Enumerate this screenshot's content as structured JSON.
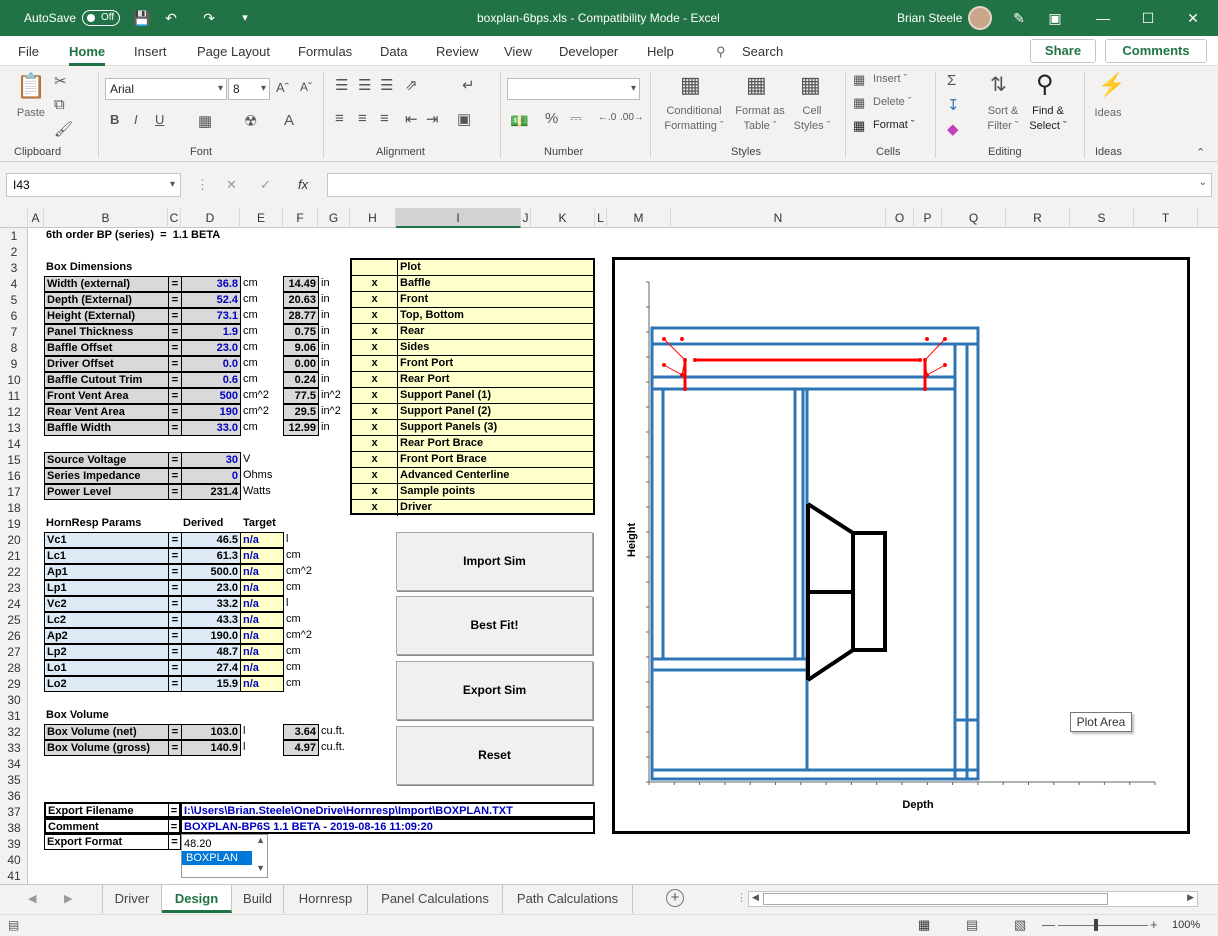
{
  "titlebar": {
    "autosave": "AutoSave",
    "toggle": "Off",
    "filename": "boxplan-6bps.xls",
    "mode": "Compatibility Mode",
    "app": "Excel",
    "user": "Brian Steele"
  },
  "menu": {
    "items": [
      "File",
      "Home",
      "Insert",
      "Page Layout",
      "Formulas",
      "Data",
      "Review",
      "View",
      "Developer",
      "Help"
    ],
    "search": "Search",
    "share": "Share",
    "comments": "Comments"
  },
  "ribbon": {
    "clipboard": {
      "label": "Clipboard",
      "paste": "Paste"
    },
    "font": {
      "label": "Font",
      "name": "Arial",
      "size": "8",
      "bold": "B",
      "italic": "I",
      "underline": "U"
    },
    "alignment": {
      "label": "Alignment"
    },
    "number": {
      "label": "Number",
      "format": ""
    },
    "styles": {
      "label": "Styles",
      "cond1": "Conditional",
      "cond2": "Formatting",
      "fmt1": "Format as",
      "fmt2": "Table",
      "cell1": "Cell",
      "cell2": "Styles"
    },
    "cells": {
      "label": "Cells",
      "insert": "Insert",
      "delete": "Delete",
      "format": "Format"
    },
    "editing": {
      "label": "Editing",
      "sort1": "Sort &",
      "sort2": "Filter",
      "find1": "Find &",
      "find2": "Select"
    },
    "ideas": {
      "label": "Ideas",
      "btn": "Ideas"
    }
  },
  "formula": {
    "namebox": "I43",
    "fx": "fx",
    "value": ""
  },
  "columns": [
    "A",
    "B",
    "C",
    "D",
    "E",
    "F",
    "G",
    "H",
    "I",
    "J",
    "K",
    "L",
    "M",
    "N",
    "O",
    "P",
    "Q",
    "R",
    "S",
    "T"
  ],
  "rows": [
    "1",
    "2",
    "3",
    "4",
    "5",
    "6",
    "7",
    "8",
    "9",
    "10",
    "11",
    "12",
    "13",
    "14",
    "15",
    "16",
    "17",
    "18",
    "19",
    "20",
    "21",
    "22",
    "23",
    "24",
    "25",
    "26",
    "27",
    "28",
    "29",
    "30",
    "31",
    "32",
    "33",
    "34",
    "35",
    "36",
    "37",
    "38",
    "39",
    "40",
    "41"
  ],
  "sheet": {
    "title": "6th order BP (series)",
    "title_eq": "=",
    "version": "1.1 BETA",
    "box_dims_header": "Box Dimensions",
    "dims": [
      {
        "label": "Width (external)",
        "value": "36.8",
        "unit": "cm",
        "imp": "14.49",
        "iunit": "in"
      },
      {
        "label": "Depth (External)",
        "value": "52.4",
        "unit": "cm",
        "imp": "20.63",
        "iunit": "in"
      },
      {
        "label": "Height (External)",
        "value": "73.1",
        "unit": "cm",
        "imp": "28.77",
        "iunit": "in"
      },
      {
        "label": "Panel Thickness",
        "value": "1.9",
        "unit": "cm",
        "imp": "0.75",
        "iunit": "in"
      },
      {
        "label": "Baffle Offset",
        "value": "23.0",
        "unit": "cm",
        "imp": "9.06",
        "iunit": "in"
      },
      {
        "label": "Driver Offset",
        "value": "0.0",
        "unit": "cm",
        "imp": "0.00",
        "iunit": "in"
      },
      {
        "label": "Baffle Cutout Trim",
        "value": "0.6",
        "unit": "cm",
        "imp": "0.24",
        "iunit": "in"
      },
      {
        "label": "Front Vent Area",
        "value": "500",
        "unit": "cm^2",
        "imp": "77.5",
        "iunit": "in^2"
      },
      {
        "label": "Rear Vent Area",
        "value": "190",
        "unit": "cm^2",
        "imp": "29.5",
        "iunit": "in^2"
      },
      {
        "label": "Baffle Width",
        "value": "33.0",
        "unit": "cm",
        "imp": "12.99",
        "iunit": "in"
      }
    ],
    "elec": [
      {
        "label": "Source Voltage",
        "value": "30",
        "unit": "V"
      },
      {
        "label": "Series Impedance",
        "value": "0",
        "unit": "Ohms"
      },
      {
        "label": "Power Level",
        "value": "231.4",
        "unit": "Watts"
      }
    ],
    "hornresp_header": "HornResp Params",
    "derived_header": "Derived",
    "target_header": "Target",
    "params": [
      {
        "label": "Vc1",
        "value": "46.5",
        "target": "n/a",
        "unit": "l"
      },
      {
        "label": "Lc1",
        "value": "61.3",
        "target": "n/a",
        "unit": "cm"
      },
      {
        "label": "Ap1",
        "value": "500.0",
        "target": "n/a",
        "unit": "cm^2"
      },
      {
        "label": "Lp1",
        "value": "23.0",
        "target": "n/a",
        "unit": "cm"
      },
      {
        "label": "Vc2",
        "value": "33.2",
        "target": "n/a",
        "unit": "l"
      },
      {
        "label": "Lc2",
        "value": "43.3",
        "target": "n/a",
        "unit": "cm"
      },
      {
        "label": "Ap2",
        "value": "190.0",
        "target": "n/a",
        "unit": "cm^2"
      },
      {
        "label": "Lp2",
        "value": "48.7",
        "target": "n/a",
        "unit": "cm"
      },
      {
        "label": "Lo1",
        "value": "27.4",
        "target": "n/a",
        "unit": "cm"
      },
      {
        "label": "Lo2",
        "value": "15.9",
        "target": "n/a",
        "unit": "cm"
      }
    ],
    "volume_header": "Box Volume",
    "volumes": [
      {
        "label": "Box Volume (net)",
        "value": "103.0",
        "unit": "l",
        "imp": "3.64",
        "iunit": "cu.ft."
      },
      {
        "label": "Box Volume (gross)",
        "value": "140.9",
        "unit": "l",
        "imp": "4.97",
        "iunit": "cu.ft."
      }
    ],
    "eq": "=",
    "plot_header": "Plot",
    "plot_items": [
      {
        "mark": "x",
        "name": "Baffle"
      },
      {
        "mark": "x",
        "name": "Front"
      },
      {
        "mark": "x",
        "name": "Top, Bottom"
      },
      {
        "mark": "x",
        "name": "Rear"
      },
      {
        "mark": "x",
        "name": "Sides"
      },
      {
        "mark": "x",
        "name": "Front Port"
      },
      {
        "mark": "x",
        "name": "Rear Port"
      },
      {
        "mark": "x",
        "name": "Support Panel (1)"
      },
      {
        "mark": "x",
        "name": "Support Panel (2)"
      },
      {
        "mark": "x",
        "name": "Support Panels (3)"
      },
      {
        "mark": "x",
        "name": "Rear Port Brace"
      },
      {
        "mark": "x",
        "name": "Front Port Brace"
      },
      {
        "mark": "x",
        "name": "Advanced Centerline"
      },
      {
        "mark": "x",
        "name": "Sample points"
      },
      {
        "mark": "x",
        "name": "Driver"
      }
    ],
    "buttons": [
      "Import Sim",
      "Best Fit!",
      "Export Sim",
      "Reset"
    ],
    "export": {
      "filename_label": "Export Filename",
      "filename": "I:\\Users\\Brian.Steele\\OneDrive\\Hornresp\\Import\\BOXPLAN.TXT",
      "comment_label": "Comment",
      "comment": "BOXPLAN-BP6S 1.1 BETA - 2019-08-16 11:09:20",
      "format_label": "Export Format",
      "format_options": [
        "48.20",
        "BOXPLAN"
      ]
    }
  },
  "chart": {
    "xlabel": "Depth",
    "ylabel": "Height",
    "tooltip": "Plot Area",
    "colors": {
      "panel": "#2e75b6",
      "port": "#ff0000",
      "driver": "#000000"
    }
  },
  "tabs": [
    "Driver",
    "Design",
    "Build",
    "Hornresp",
    "Panel Calculations",
    "Path Calculations"
  ],
  "status": {
    "zoom": "100%"
  }
}
